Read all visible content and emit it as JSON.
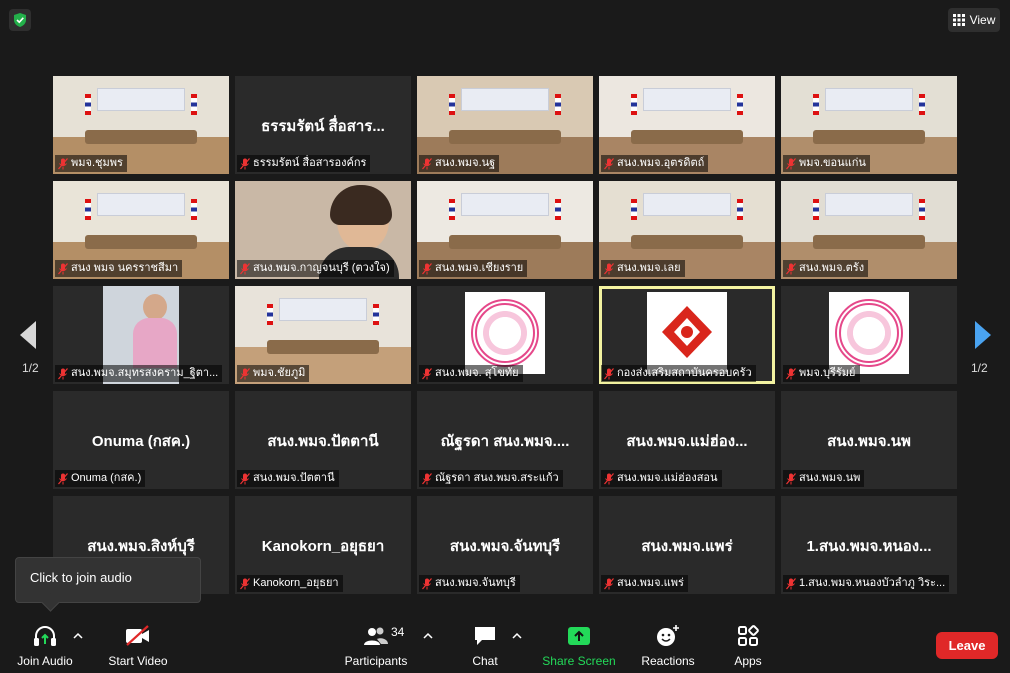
{
  "topbar": {
    "view_label": "View"
  },
  "tiles": [
    {
      "name": "",
      "label": "พมจ.ชุมพร",
      "kind": "room"
    },
    {
      "name": "ธรรมรัตน์ สื่อสาร...",
      "label": "ธรรมรัตน์ สื่อสารองค์กร",
      "kind": "blank"
    },
    {
      "name": "",
      "label": "สนง.พมจ.นฐ",
      "kind": "room"
    },
    {
      "name": "",
      "label": "สนง.พมจ.อุตรดิตถ์",
      "kind": "room"
    },
    {
      "name": "",
      "label": "พมจ.ขอนแก่น",
      "kind": "room"
    },
    {
      "name": "",
      "label": "สนง พมจ นครราชสีมา",
      "kind": "room"
    },
    {
      "name": "",
      "label": "สนง.พมจ.กาญจนบุรี (ตวงใจ)",
      "kind": "person"
    },
    {
      "name": "",
      "label": "สนง.พมจ.เชียงราย",
      "kind": "room"
    },
    {
      "name": "",
      "label": "สนง.พมจ.เลย",
      "kind": "room"
    },
    {
      "name": "",
      "label": "สนง.พมจ.ตรัง",
      "kind": "room"
    },
    {
      "name": "",
      "label": "สนง.พมจ.สมุทรสงคราม_ฐิตา...",
      "kind": "person-small"
    },
    {
      "name": "",
      "label": "พมจ.ชัยภูมิ",
      "kind": "room"
    },
    {
      "name": "",
      "label": "สนง.พมจ. สุโขทัย",
      "kind": "seal"
    },
    {
      "name": "",
      "label": "กองส่งเสริมสถาบันครอบครัว",
      "kind": "logo",
      "active": true
    },
    {
      "name": "",
      "label": "พมจ.บุรีรัมย์",
      "kind": "seal"
    },
    {
      "name": "Onuma (กสค.)",
      "label": "Onuma (กสค.)",
      "kind": "blank"
    },
    {
      "name": "สนง.พมจ.ปัตตานี",
      "label": "สนง.พมจ.ปัตตานี",
      "kind": "blank"
    },
    {
      "name": "ณัฐรดา สนง.พมจ....",
      "label": "ณัฐรดา สนง.พมจ.สระแก้ว",
      "kind": "blank"
    },
    {
      "name": "สนง.พมจ.แม่ฮ่อง...",
      "label": "สนง.พมจ.แม่ฮ่องสอน",
      "kind": "blank"
    },
    {
      "name": "สนง.พมจ.นพ",
      "label": "สนง.พมจ.นพ",
      "kind": "blank"
    },
    {
      "name": "สนง.พมจ.สิงห์บุรี",
      "label": "สนง.พมจ.สิงห์บุรี",
      "kind": "blank"
    },
    {
      "name": "Kanokorn_อยุธยา",
      "label": "Kanokorn_อยุธยา",
      "kind": "blank"
    },
    {
      "name": "สนง.พมจ.จันทบุรี",
      "label": "สนง.พมจ.จันทบุรี",
      "kind": "blank"
    },
    {
      "name": "สนง.พมจ.แพร่",
      "label": "สนง.พมจ.แพร่",
      "kind": "blank"
    },
    {
      "name": "1.สนง.พมจ.หนอง...",
      "label": "1.สนง.พมจ.หนองบัวลำภู วิระ...",
      "kind": "blank"
    }
  ],
  "pagination": {
    "left": "1/2",
    "right": "1/2"
  },
  "tooltip": {
    "text": "Click to join audio"
  },
  "toolbar": {
    "join_audio": "Join Audio",
    "start_video": "Start Video",
    "participants": "Participants",
    "participants_count": "34",
    "chat": "Chat",
    "share_screen": "Share Screen",
    "reactions": "Reactions",
    "apps": "Apps",
    "leave": "Leave"
  },
  "colors": {
    "share_green": "#23d959",
    "leave_red": "#e02828",
    "active_border": "#f2f2a0",
    "arrow_blue": "#4aa3f0"
  }
}
